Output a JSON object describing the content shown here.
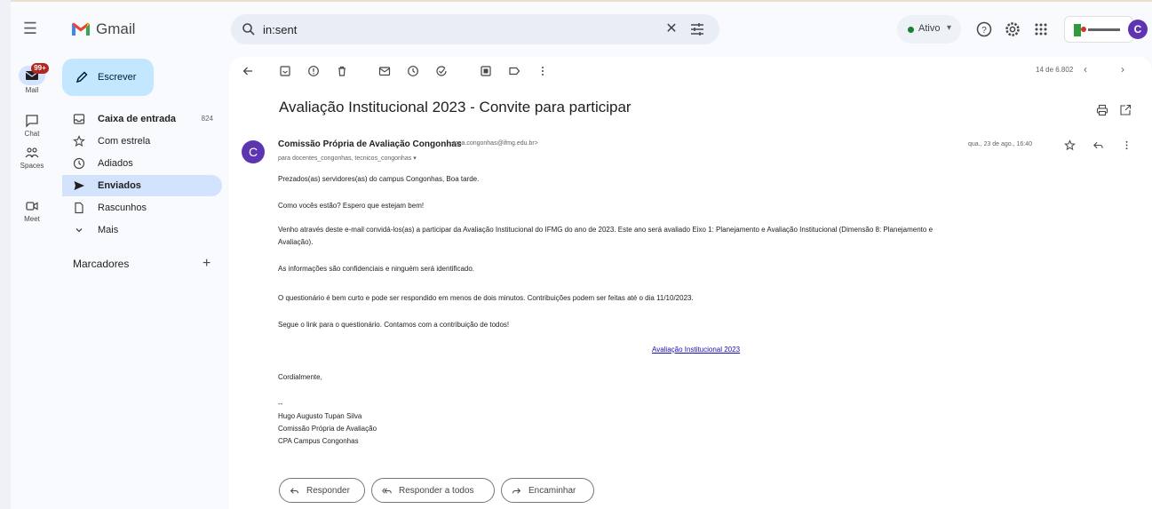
{
  "app": {
    "name": "Gmail",
    "accent_color": "#c2e7ff",
    "active_nav_color": "#d3e3fd",
    "avatar_letter": "C",
    "avatar_color": "#5e35b1"
  },
  "search": {
    "value": "in:sent",
    "icon": "search-icon"
  },
  "header": {
    "status_label": "Ativo",
    "status_color": "#188038"
  },
  "rail": {
    "items": [
      {
        "label": "Mail",
        "icon": "mail-icon"
      },
      {
        "label": "Chat",
        "icon": "chat-icon"
      },
      {
        "label": "Spaces",
        "icon": "spaces-icon"
      },
      {
        "label": "Meet",
        "icon": "meet-icon"
      }
    ],
    "mail_badge": "99+"
  },
  "compose": {
    "label": "Escrever"
  },
  "nav": {
    "items": [
      {
        "label": "Caixa de entrada",
        "count": "824",
        "icon": "inbox-icon",
        "bold": true
      },
      {
        "label": "Com estrela",
        "count": "",
        "icon": "star-icon"
      },
      {
        "label": "Adiados",
        "count": "",
        "icon": "clock-icon"
      },
      {
        "label": "Enviados",
        "count": "",
        "icon": "send-icon",
        "active": true
      },
      {
        "label": "Rascunhos",
        "count": "",
        "icon": "draft-icon"
      },
      {
        "label": "Mais",
        "count": "",
        "icon": "chevron-down-icon"
      }
    ],
    "labels_heading": "Marcadores"
  },
  "toolbar": {
    "pager": "14 de 6.802"
  },
  "email": {
    "subject": "Avaliação Institucional 2023 - Convite para participar",
    "sender_name": "Comissão Própria de Avaliação Congonhas",
    "sender_email": "<cpa.congonhas@ifmg.edu.br>",
    "recipients": "para docentes_congonhas, tecnicos_congonhas",
    "date": "qua., 23 de ago., 16:40",
    "body": [
      "Prezados(as) servidores(as) do campus Congonhas, Boa tarde.",
      "Como vocês estão? Espero que estejam bem!",
      "Venho através deste e-mail convidá-los(as) a participar da Avaliação Institucional do IFMG do ano de 2023. Este ano será avaliado Eixo 1: Planejamento e Avaliação Institucional (Dimensão 8: Planejamento e",
      "Avaliação).",
      "As informações são confidenciais e ninguém será identificado.",
      "O questionário é bem curto e pode ser respondido em menos de dois minutos. Contribuições podem ser feitas até o dia 11/10/2023.",
      "Segue o link para o questionário. Contamos com a contribuição de todos!"
    ],
    "link_text": "Avaliação Institucional 2023",
    "closing": "Cordialmente,",
    "signature": [
      "--",
      "Hugo Augusto Tupan Silva",
      "Comissão Própria de Avaliação",
      "CPA Campus Congonhas"
    ]
  },
  "actions": {
    "reply": "Responder",
    "reply_all": "Responder a todos",
    "forward": "Encaminhar"
  }
}
